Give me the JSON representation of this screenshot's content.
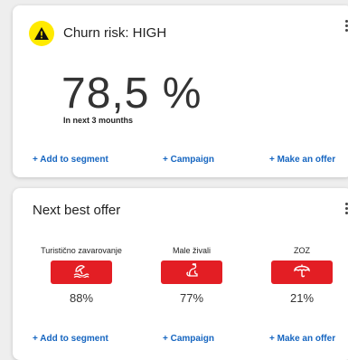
{
  "churn": {
    "title": "Churn risk: HIGH",
    "value": "78,5 %",
    "subtitle": "In next 3 mounths",
    "icon": "warning-icon",
    "icon_color": "#ffea00",
    "actions": [
      "+ Add to segment",
      "+ Campaign",
      "+ Make an offer"
    ]
  },
  "offer": {
    "title": "Next best offer",
    "items": [
      {
        "name": "Turistično zavarovanje",
        "percent": "88%",
        "icon": "travel-insurance-icon"
      },
      {
        "name": "Male živali",
        "percent": "77%",
        "icon": "pet-icon"
      },
      {
        "name": "ZOZ",
        "percent": "21%",
        "icon": "umbrella-icon"
      }
    ],
    "actions": [
      "+ Add to segment",
      "+ Campaign",
      "+ Make an offer"
    ]
  },
  "colors": {
    "accent": "#e31e24",
    "link": "#1565c0"
  }
}
